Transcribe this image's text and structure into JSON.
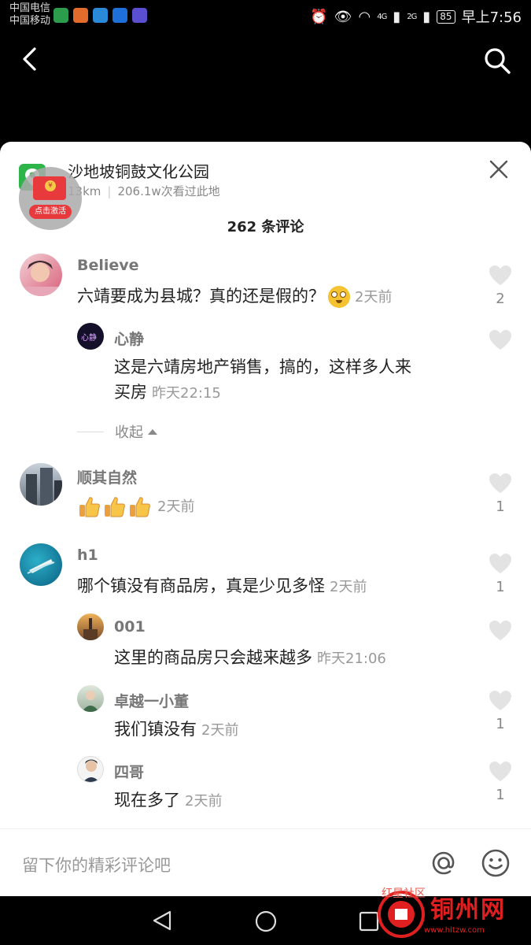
{
  "status_bar": {
    "carrier1": "中国电信",
    "carrier2": "中国移动",
    "network1": "4G",
    "network2": "2G",
    "battery": "85",
    "time": "早上7:56"
  },
  "location": {
    "name": "沙地坡铜鼓文化公园",
    "distance": "13km",
    "views": "206.1w次看过此地"
  },
  "red_packet": {
    "label": "点击激活",
    "coin": "¥"
  },
  "comment_count": "262 条评论",
  "comments": [
    {
      "user": "Believe",
      "text": "六靖要成为县城？真的还是假的？",
      "time": "2天前",
      "likes": "2"
    },
    {
      "user": "心静",
      "avatar_text": "心静",
      "text": "这是六靖房地产销售，搞的，这样多人来",
      "text2": "买房",
      "time": "昨天22:15",
      "likes": ""
    },
    {
      "user": "顺其自然",
      "time": "2天前",
      "likes": "1"
    },
    {
      "user": "h1",
      "text": "哪个镇没有商品房，真是少见多怪",
      "time": "2天前",
      "likes": "1"
    },
    {
      "user": "001",
      "text": "这里的商品房只会越来越多",
      "time": "昨天21:06",
      "likes": ""
    },
    {
      "user": "卓越一小董",
      "text": "我们镇没有",
      "time": "2天前",
      "likes": "1"
    },
    {
      "user": "四哥",
      "text": "现在多了",
      "time": "2天前",
      "likes": "1"
    }
  ],
  "collapse_label": "收起",
  "input_placeholder": "留下你的精彩评论吧",
  "icons": [
    "back-icon",
    "search-icon",
    "close-icon",
    "heart-icon",
    "at-icon",
    "emoji-icon",
    "nav-back-icon",
    "nav-home-icon",
    "nav-recent-icon"
  ],
  "watermark": {
    "main": "铜州网",
    "sub": "红星社区",
    "url": "www.hltzw.com"
  },
  "colors": {
    "accent_red": "#e8393d",
    "location_green": "#2db54a",
    "muted": "#999999"
  }
}
